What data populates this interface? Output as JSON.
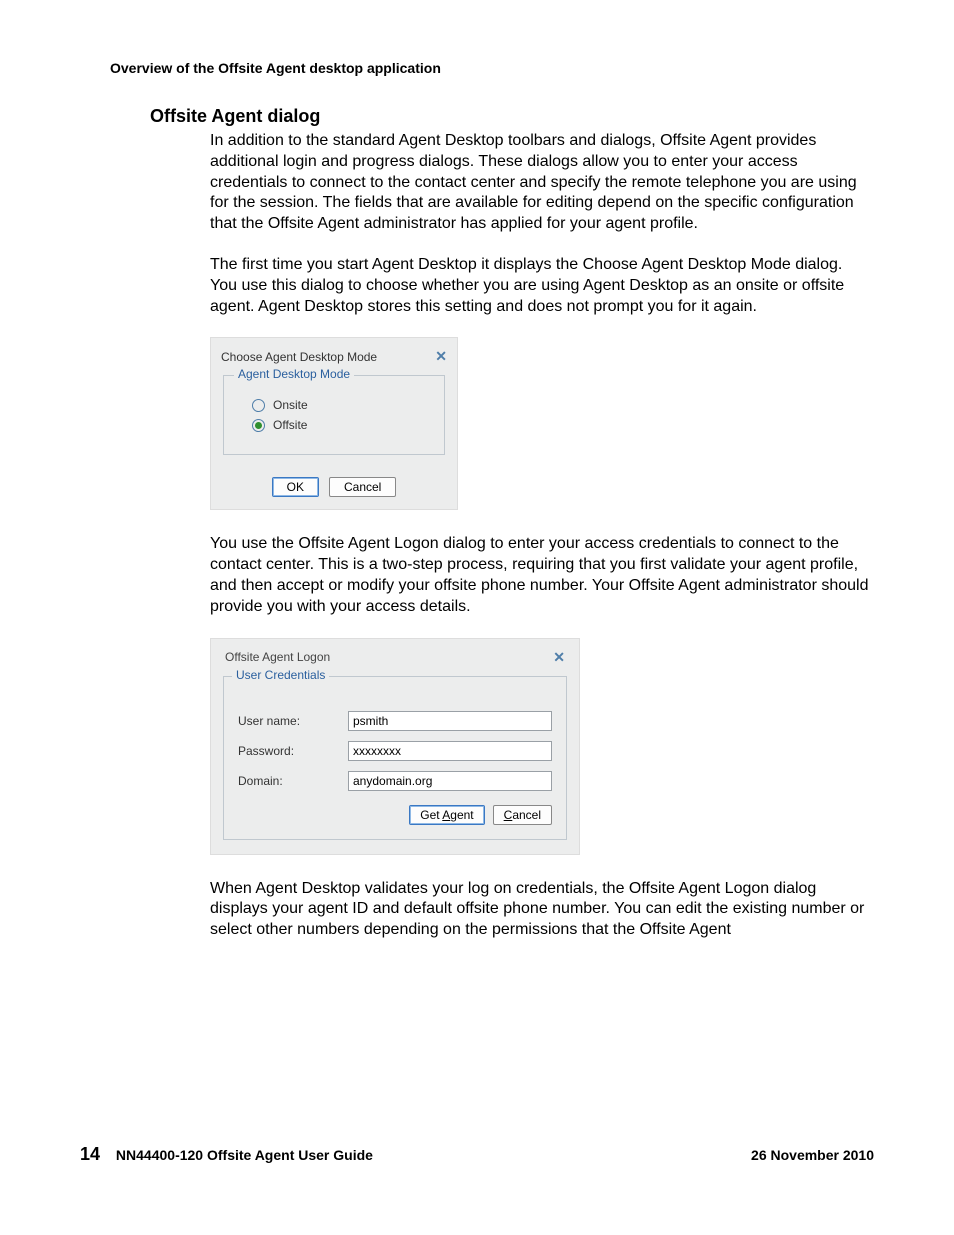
{
  "runningHead": "Overview of the Offsite Agent desktop application",
  "sectionTitle": "Offsite Agent dialog",
  "para1": "In addition to the standard Agent Desktop toolbars and dialogs, Offsite Agent provides additional login and progress dialogs. These dialogs allow you to enter your access credentials to connect to the contact center and specify the remote telephone you are using for the session. The fields that are available for editing depend on the specific configuration that the Offsite Agent administrator has applied for your agent profile.",
  "para2": "The first time you start Agent Desktop it displays the Choose Agent Desktop Mode dialog. You use this dialog to choose whether you are using Agent Desktop as an onsite or offsite agent. Agent Desktop stores this setting and does not prompt you for it again.",
  "dialog1": {
    "title": "Choose Agent Desktop Mode",
    "groupLegend": "Agent Desktop Mode",
    "optionOnsite": "Onsite",
    "optionOffsite": "Offsite",
    "selected": "Offsite",
    "ok": "OK",
    "cancel": "Cancel"
  },
  "para3": "You use the Offsite Agent Logon dialog to enter your access credentials to connect to the contact center. This is a two-step process, requiring that you first validate your agent profile, and then accept or modify your offsite phone number. Your Offsite Agent administrator should provide you with your access details.",
  "dialog2": {
    "title": "Offsite Agent Logon",
    "groupLegend": "User Credentials",
    "labels": {
      "user": "User name:",
      "pass": "Password:",
      "domain": "Domain:"
    },
    "values": {
      "user": "psmith",
      "pass": "xxxxxxxx",
      "domain": "anydomain.org"
    },
    "getAgent": {
      "pre": "Get ",
      "mn": "A",
      "post": "gent"
    },
    "cancel": {
      "mn": "C",
      "post": "ancel"
    }
  },
  "para4": "When Agent Desktop validates your log on credentials, the Offsite Agent Logon dialog displays your agent ID and default offsite phone number. You can edit the existing number or select other numbers depending on the permissions that the Offsite Agent",
  "footer": {
    "pageNum": "14",
    "docTitle": "NN44400-120 Offsite Agent User Guide",
    "date": "26 November 2010"
  }
}
